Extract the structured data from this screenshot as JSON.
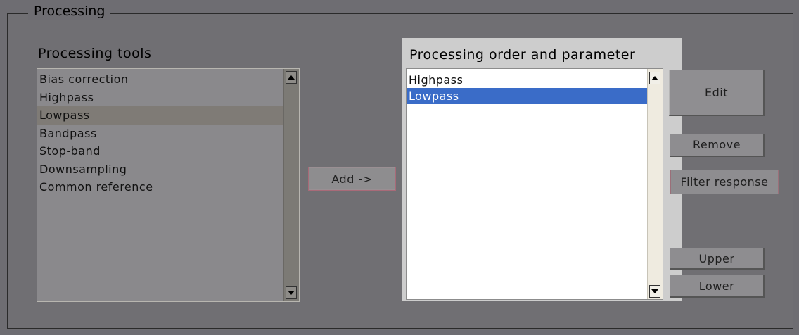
{
  "group": {
    "title": "Processing"
  },
  "tools": {
    "label": "Processing tools",
    "items": [
      {
        "label": "Bias correction"
      },
      {
        "label": "Highpass"
      },
      {
        "label": "Lowpass"
      },
      {
        "label": "Bandpass"
      },
      {
        "label": "Stop-band"
      },
      {
        "label": "Downsampling"
      },
      {
        "label": "Common reference"
      }
    ],
    "hovered_index": 2
  },
  "add_button": {
    "label": "Add ->"
  },
  "order": {
    "label": "Processing order and parameter",
    "items": [
      {
        "label": "Highpass"
      },
      {
        "label": "Lowpass"
      }
    ],
    "selected_index": 1
  },
  "side_buttons": {
    "edit": "Edit",
    "remove": "Remove",
    "filter_response": "Filter response",
    "upper": "Upper",
    "lower": "Lower"
  },
  "colors": {
    "selection": "#3a6cc8",
    "panel_highlight": "#cfcfcf"
  }
}
